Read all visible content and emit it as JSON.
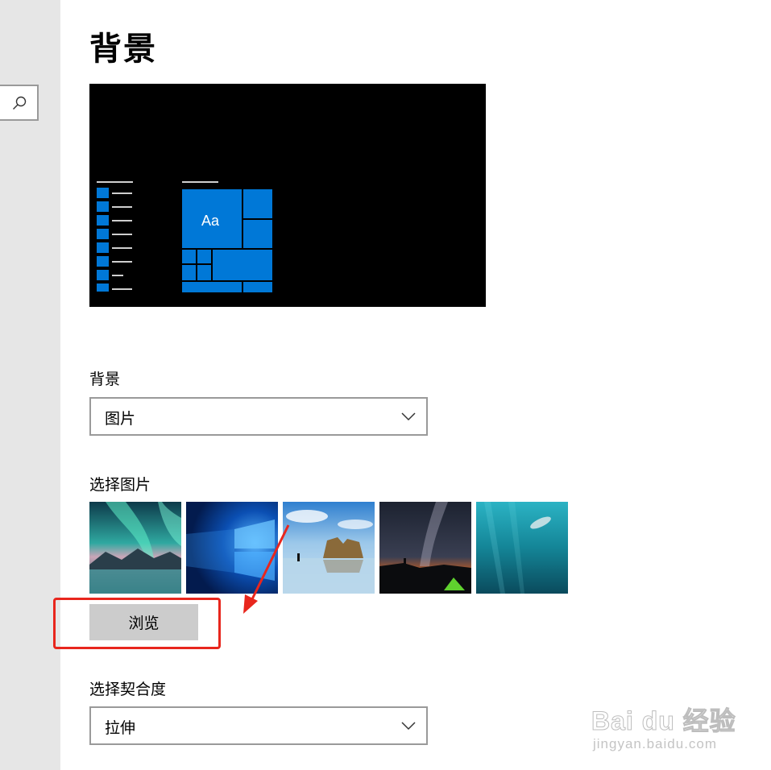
{
  "page": {
    "title": "背景"
  },
  "sidebar": {
    "search_icon": "search-icon"
  },
  "preview": {
    "tile_text": "Aa",
    "accent_color": "#0078d7"
  },
  "background_section": {
    "label": "背景",
    "dropdown_value": "图片"
  },
  "choose_picture": {
    "label": "选择图片",
    "browse_label": "浏览",
    "thumbnails": [
      "aurora-lake",
      "windows-10-light",
      "beach-rock-arch",
      "night-sky-tent",
      "underwater-swimmer"
    ]
  },
  "fit_section": {
    "label": "选择契合度",
    "dropdown_value": "拉伸"
  },
  "annotation": {
    "highlight_color": "#e8261d"
  },
  "watermark": {
    "logo_text": "Bai du 经验",
    "url_text": "jingyan.baidu.com"
  }
}
